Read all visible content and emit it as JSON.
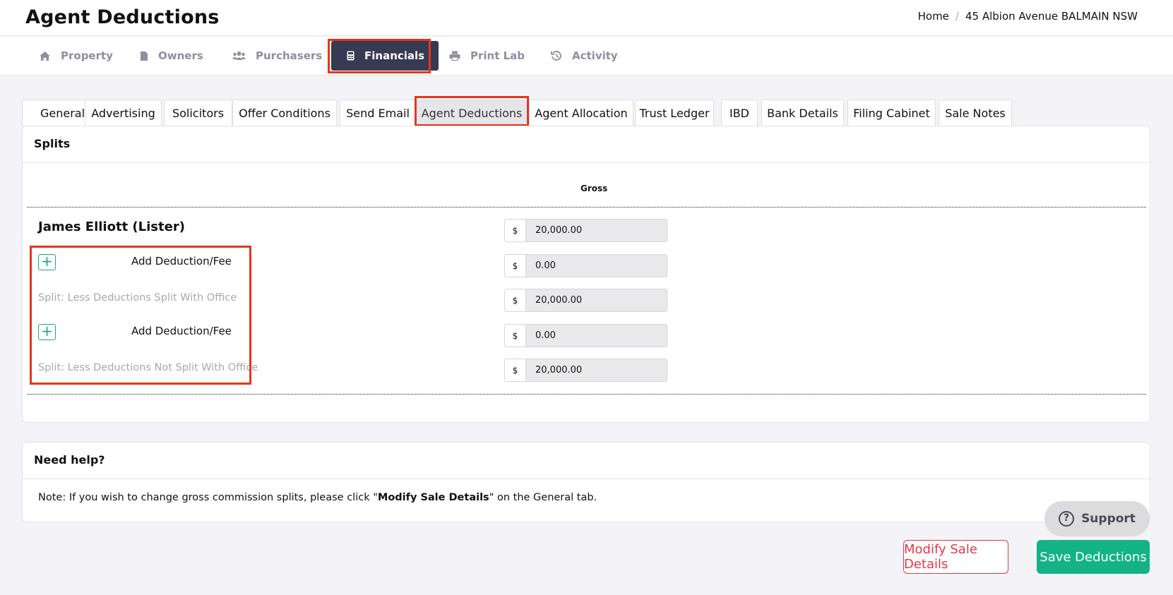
{
  "header": {
    "title": "Agent Deductions",
    "breadcrumb": [
      "Home",
      "45 Albion Avenue BALMAIN NSW"
    ]
  },
  "main_nav": [
    {
      "label": "Property",
      "icon": "home-icon"
    },
    {
      "label": "Owners",
      "icon": "file-icon"
    },
    {
      "label": "Purchasers",
      "icon": "users-icon"
    },
    {
      "label": "Financials",
      "icon": "calculator-icon",
      "active": true
    },
    {
      "label": "Print Lab",
      "icon": "printer-icon"
    },
    {
      "label": "Activity",
      "icon": "history-icon"
    }
  ],
  "sub_tabs": [
    {
      "label": "General"
    },
    {
      "label": "Advertising"
    },
    {
      "label": "Solicitors"
    },
    {
      "label": "Offer Conditions"
    },
    {
      "label": "Send Email"
    },
    {
      "label": "Agent Deductions",
      "active": true
    },
    {
      "label": "Agent Allocation"
    },
    {
      "label": "Trust Ledger"
    },
    {
      "label": "IBD"
    },
    {
      "label": "Bank Details"
    },
    {
      "label": "Filing Cabinet"
    },
    {
      "label": "Sale Notes"
    }
  ],
  "splits": {
    "title": "Splits",
    "column_header": "Gross",
    "agent_name": "James Elliott (Lister)",
    "add_deduction_label": "Add Deduction/Fee",
    "split_with_office_label": "Split: Less Deductions Split With Office",
    "split_not_with_office_label": "Split: Less Deductions Not Split With Office",
    "currency": "$",
    "values": {
      "gross": "20,000.00",
      "deduction_1": "0.00",
      "split_with_office": "20,000.00",
      "deduction_2": "0.00",
      "split_not_with_office": "20,000.00"
    }
  },
  "help": {
    "title": "Need help?",
    "note_prefix": "Note: If you wish to change gross commission splits, please click \"",
    "note_bold": "Modify Sale Details",
    "note_suffix": "\" on the General tab."
  },
  "support_label": "Support",
  "buttons": {
    "modify": "Modify Sale Details",
    "save": "Save Deductions"
  },
  "colors": {
    "accent_green": "#14b386",
    "nav_active": "#363a52",
    "danger": "#e0394a",
    "highlight": "#e8341c"
  }
}
